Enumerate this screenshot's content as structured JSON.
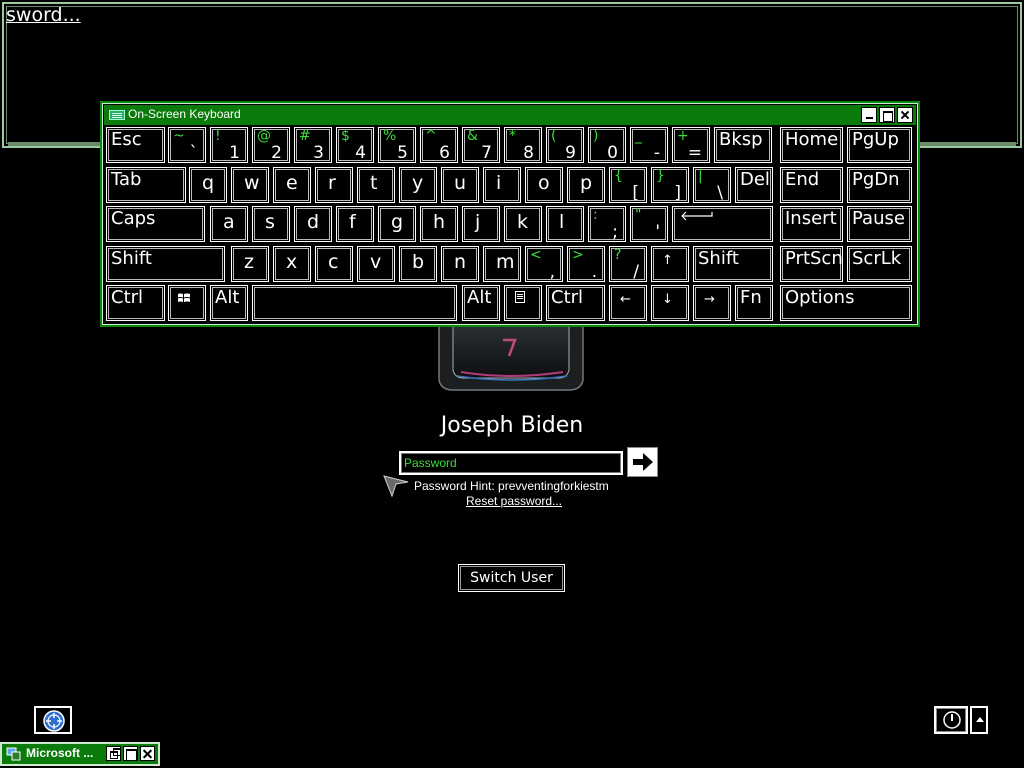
{
  "background_window": {
    "visible_text": "sword..."
  },
  "keyboard": {
    "title": "On-Screen Keyboard",
    "rows": [
      [
        {
          "label": "Esc"
        },
        {
          "shift": "~",
          "base": "`"
        },
        {
          "shift": "!",
          "base": "1"
        },
        {
          "shift": "@",
          "base": "2"
        },
        {
          "shift": "#",
          "base": "3"
        },
        {
          "shift": "$",
          "base": "4"
        },
        {
          "shift": "%",
          "base": "5"
        },
        {
          "shift": "^",
          "base": "6"
        },
        {
          "shift": "&",
          "base": "7"
        },
        {
          "shift": "*",
          "base": "8"
        },
        {
          "shift": "(",
          "base": "9"
        },
        {
          "shift": ")",
          "base": "0"
        },
        {
          "shift": "_",
          "base": "-"
        },
        {
          "shift": "+",
          "base": "="
        },
        {
          "label": "Bksp"
        },
        {
          "label": "Home"
        },
        {
          "label": "PgUp"
        }
      ],
      [
        {
          "label": "Tab"
        },
        {
          "char": "q"
        },
        {
          "char": "w"
        },
        {
          "char": "e"
        },
        {
          "char": "r"
        },
        {
          "char": "t"
        },
        {
          "char": "y"
        },
        {
          "char": "u"
        },
        {
          "char": "i"
        },
        {
          "char": "o"
        },
        {
          "char": "p"
        },
        {
          "shift": "{",
          "base": "["
        },
        {
          "shift": "}",
          "base": "]"
        },
        {
          "shift": "|",
          "base": "\\"
        },
        {
          "label": "Del"
        },
        {
          "label": "End"
        },
        {
          "label": "PgDn"
        }
      ],
      [
        {
          "label": "Caps"
        },
        {
          "char": "a"
        },
        {
          "char": "s"
        },
        {
          "char": "d"
        },
        {
          "char": "f"
        },
        {
          "char": "g"
        },
        {
          "char": "h"
        },
        {
          "char": "j"
        },
        {
          "char": "k"
        },
        {
          "char": "l"
        },
        {
          "shift": ":",
          "base": ";"
        },
        {
          "shift": "\"",
          "base": "'"
        },
        {
          "icon": "enter-arrow-icon"
        },
        {
          "label": "Insert"
        },
        {
          "label": "Pause"
        }
      ],
      [
        {
          "label": "Shift"
        },
        {
          "char": "z"
        },
        {
          "char": "x"
        },
        {
          "char": "c"
        },
        {
          "char": "v"
        },
        {
          "char": "b"
        },
        {
          "char": "n"
        },
        {
          "char": "m"
        },
        {
          "shift": "<",
          "base": ","
        },
        {
          "shift": ">",
          "base": "."
        },
        {
          "shift": "?",
          "base": "/"
        },
        {
          "symbol": "↑"
        },
        {
          "label": "Shift"
        },
        {
          "label": "PrtScn"
        },
        {
          "label": "ScrLk"
        }
      ],
      [
        {
          "label": "Ctrl"
        },
        {
          "icon": "windows-logo-icon"
        },
        {
          "label": "Alt"
        },
        {
          "label": ""
        },
        {
          "label": "Alt"
        },
        {
          "icon": "menu-key-icon"
        },
        {
          "label": "Ctrl"
        },
        {
          "symbol": "←"
        },
        {
          "symbol": "↓"
        },
        {
          "symbol": "→"
        },
        {
          "label": "Fn"
        },
        {
          "label": "Options"
        }
      ]
    ]
  },
  "logon": {
    "user_name": "Joseph Biden",
    "password_placeholder": "Password",
    "password_hint": "Password Hint: prevventingforkiestm",
    "reset_link": "Reset password...",
    "switch_user": "Switch User"
  },
  "taskbar_window": {
    "label": "Microsoft ..."
  },
  "colors": {
    "accent_green": "#0a7a0a",
    "key_shift_text": "#3bdc3b",
    "background": "#000000"
  }
}
